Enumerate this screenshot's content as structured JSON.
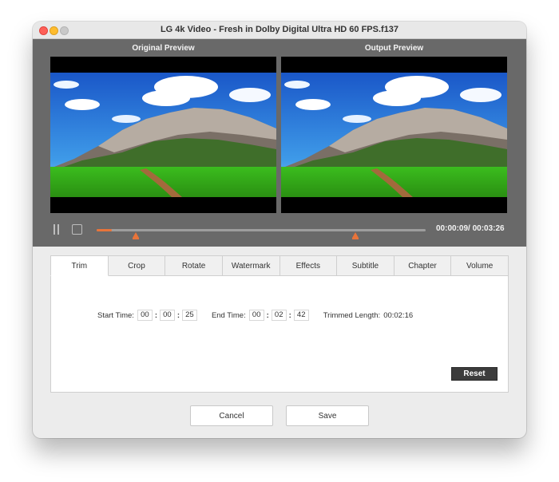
{
  "window": {
    "title": "LG 4k Video - Fresh in Dolby Digital Ultra HD 60 FPS.f137"
  },
  "previews": {
    "original_label": "Original Preview",
    "output_label": "Output  Preview"
  },
  "playback": {
    "time": "00:00:09/ 00:03:26",
    "progress": 0.047,
    "trim_start_marker": 0.12,
    "trim_end_marker": 0.786
  },
  "tabs": [
    "Trim",
    "Crop",
    "Rotate",
    "Watermark",
    "Effects",
    "Subtitle",
    "Chapter",
    "Volume"
  ],
  "active_tab": "Trim",
  "trim": {
    "start_label": "Start Time:",
    "start": {
      "h": "00",
      "m": "00",
      "s": "25"
    },
    "end_label": "End Time:",
    "end": {
      "h": "00",
      "m": "02",
      "s": "42"
    },
    "length_label": "Trimmed Length:",
    "length": "00:02:16",
    "separator": ":"
  },
  "buttons": {
    "reset": "Reset",
    "cancel": "Cancel",
    "save": "Save"
  },
  "colors": {
    "accent": "#e8743a",
    "player_bg": "#696969",
    "reset_bg": "#3c3c3c"
  }
}
